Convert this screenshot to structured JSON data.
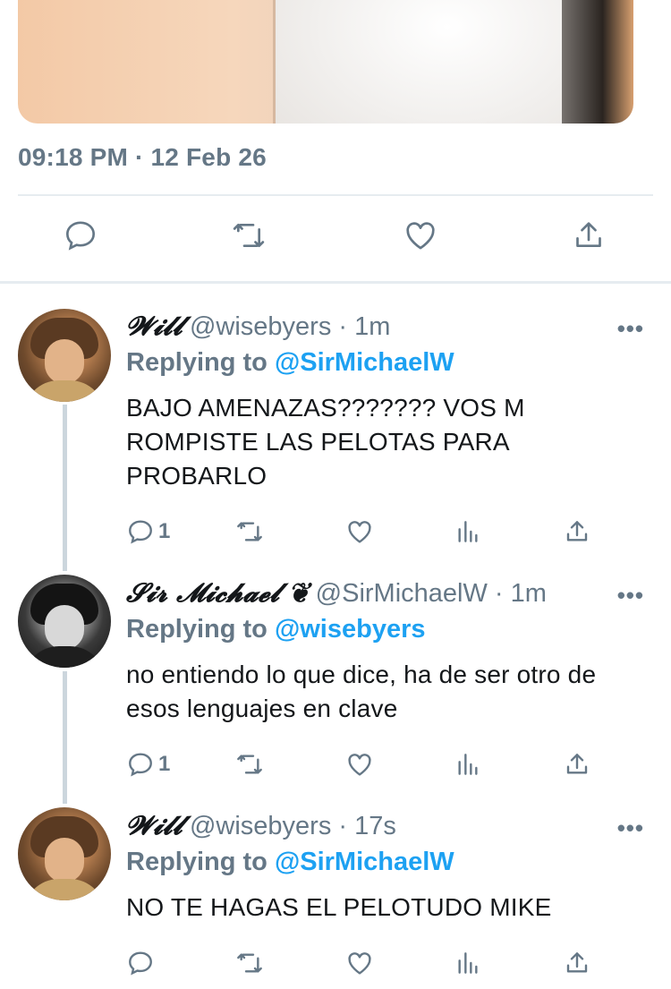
{
  "tweet_main": {
    "timestamp": "09:18 PM · 12 Feb 26"
  },
  "replies": [
    {
      "name": "𝓦𝓲𝓵𝓵",
      "handle": "@wisebyers",
      "time": "1m",
      "replying_label": "Replying to",
      "replying_to": "@SirMichaelW",
      "text": "BAJO AMENAZAS???????  VOS M ROMPISTE LAS PELOTAS PARA PROBARLO",
      "reply_count": "1"
    },
    {
      "name": "𝓢𝓲𝓻 𝓜𝓲𝓬𝓱𝓪𝓮𝓵 ❦",
      "handle": "@SirMichaelW",
      "time": "1m",
      "replying_label": "Replying to",
      "replying_to": "@wisebyers",
      "text": "no entiendo lo que dice, ha de ser otro de esos lenguajes en clave",
      "reply_count": "1"
    },
    {
      "name": "𝓦𝓲𝓵𝓵",
      "handle": "@wisebyers",
      "time": "17s",
      "replying_label": "Replying to",
      "replying_to": "@SirMichaelW",
      "text": "NO TE HAGAS EL PELOTUDO MIKE",
      "reply_count": ""
    }
  ],
  "separator": "·",
  "more_glyph": "•••",
  "colors": {
    "accent": "#1da1f2",
    "muted": "#657786",
    "divider": "#e6ecf0"
  },
  "icons": [
    "reply-icon",
    "retweet-icon",
    "like-icon",
    "analytics-icon",
    "share-icon",
    "more-icon"
  ]
}
